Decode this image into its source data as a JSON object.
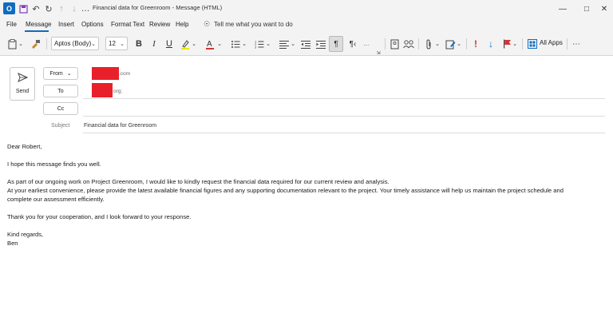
{
  "window": {
    "app_logo": "O",
    "title": "Financial data for Greenroom  -  Message (HTML)"
  },
  "menu": {
    "items": [
      "File",
      "Message",
      "Insert",
      "Options",
      "Format Text",
      "Review",
      "Help"
    ],
    "active": "Message",
    "tell_me": "Tell me what you want to do"
  },
  "ribbon": {
    "font_family": "Aptos (Body)",
    "font_size": "12",
    "all_apps_label": "All Apps"
  },
  "compose": {
    "send_label": "Send",
    "from_label": "From",
    "to_label": "To",
    "cc_label": "Cc",
    "subject_label": "Subject",
    "subject_value": "Financial data for Greenroom",
    "from_suffix": ".com",
    "to_suffix": "org;",
    "redaction_color": "#e8202a"
  },
  "body": {
    "greeting": "Dear Robert,",
    "line1": "I hope this message finds you well.",
    "para2_line1": "As part of our ongoing work on Project Greenroom, I would like to kindly request the financial data required for our current review and analysis.",
    "para2_line2": "At your earliest convenience, please provide the latest available financial figures and any supporting documentation relevant to the project. Your timely assistance will help us maintain the project schedule and",
    "para2_line3": "complete our assessment efficiently.",
    "thanks": "Thank you for your cooperation, and I look forward to your response.",
    "closing": "Kind regards,",
    "signature": "Ben"
  },
  "colors": {
    "accent": "#0f6cbd",
    "toolbar_bg": "#f3f3f3",
    "flag_red": "#d13438"
  }
}
